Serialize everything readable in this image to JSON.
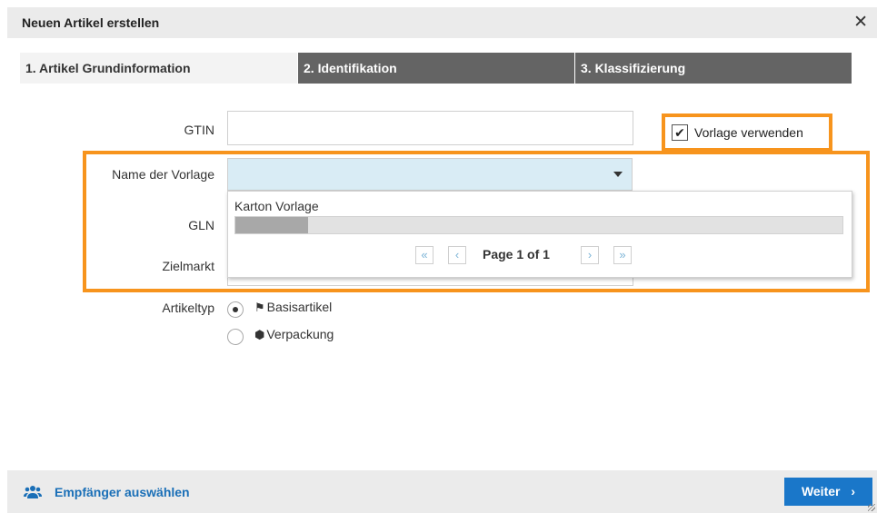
{
  "dialog": {
    "title": "Neuen Artikel erstellen",
    "close_icon": "close-icon"
  },
  "steps": [
    {
      "label": "1. Artikel Grundinformation",
      "active": true
    },
    {
      "label": "2. Identifikation",
      "active": false
    },
    {
      "label": "3. Klassifizierung",
      "active": false
    }
  ],
  "form": {
    "gtin_label": "GTIN",
    "gtin_value": "",
    "use_template_label": "Vorlage verwenden",
    "use_template_checked": true,
    "template_name_label": "Name der Vorlage",
    "template_name_value": "",
    "gln_label": "GLN",
    "target_market_label": "Zielmarkt",
    "article_type_label": "Artikeltyp",
    "article_types": [
      {
        "label": "Basisartikel",
        "icon": "flag-icon",
        "selected": true
      },
      {
        "label": "Verpackung",
        "icon": "cube-icon",
        "selected": false
      }
    ]
  },
  "dropdown": {
    "items": [
      "Karton Vorlage"
    ],
    "scroll_fraction": 0.12,
    "pager_text": "Page 1 of 1"
  },
  "footer": {
    "recipients_link": "Empfänger auswählen",
    "recipients_icon": "users-icon",
    "next_button": "Weiter",
    "next_icon": "chevron-right-icon"
  },
  "colors": {
    "highlight": "#f7941d",
    "accent": "#1a77c9",
    "step_inactive": "#646464",
    "select_bg": "#d9ecf5"
  }
}
